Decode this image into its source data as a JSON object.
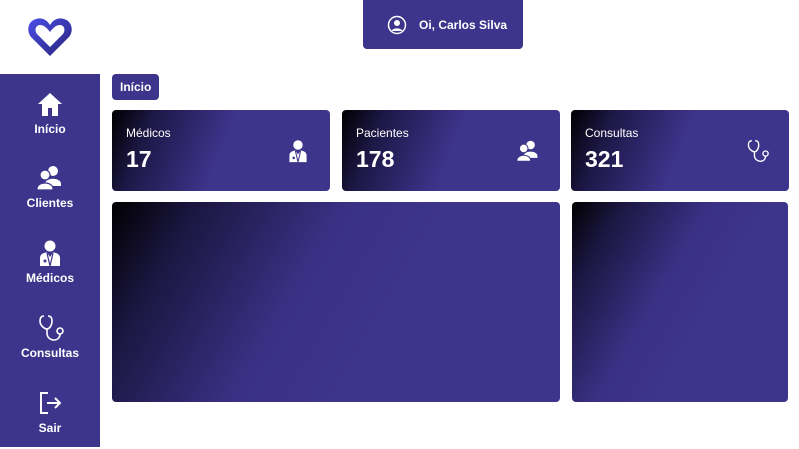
{
  "header": {
    "greeting": "Oi, Carlos Silva"
  },
  "breadcrumb": {
    "label": "Início"
  },
  "sidebar": {
    "items": [
      {
        "label": "Início",
        "icon": "home-icon"
      },
      {
        "label": "Clientes",
        "icon": "users-icon"
      },
      {
        "label": "Médicos",
        "icon": "doctor-icon"
      },
      {
        "label": "Consultas",
        "icon": "stethoscope-icon"
      },
      {
        "label": "Sair",
        "icon": "logout-icon"
      }
    ]
  },
  "stats": [
    {
      "title": "Médicos",
      "value": "17",
      "icon": "doctor-icon"
    },
    {
      "title": "Pacientes",
      "value": "178",
      "icon": "users-icon"
    },
    {
      "title": "Consultas",
      "value": "321",
      "icon": "stethoscope-icon"
    }
  ],
  "colors": {
    "primary": "#3d348b",
    "logo_blue": "#3b3fd6"
  }
}
